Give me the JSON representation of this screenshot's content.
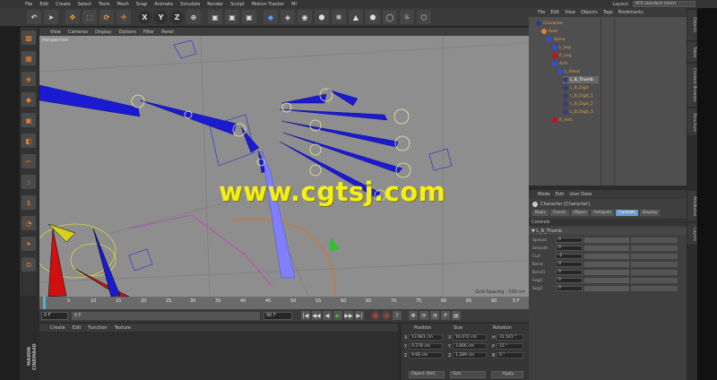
{
  "menubar": {
    "items": [
      "File",
      "Edit",
      "Create",
      "Select",
      "Tools",
      "Mesh",
      "Snap",
      "Animate",
      "Simulate",
      "Render",
      "Sculpt",
      "Motion Tracker",
      "Mi"
    ],
    "layout_label": "Layout:",
    "layout_value": "VFX standard (User)"
  },
  "toolbar": {
    "x_label": "X",
    "y_label": "Y",
    "z_label": "Z",
    "undo_icon": "↶",
    "pointer_icon": "➤",
    "move_icon": "✥",
    "scale_icon": "⬚",
    "rotate_icon": "⟳",
    "add_icon": "✛",
    "world_icon": "⊕",
    "render_icons": [
      "▣",
      "▣",
      "▣"
    ],
    "shape_icons": [
      "◆",
      "◈",
      "◉",
      "⬢",
      "❋",
      "▲",
      "⬣",
      "◯",
      "☼",
      "⬡"
    ]
  },
  "left_tools": [
    "▩",
    "▦",
    "◈",
    "◆",
    "▣",
    "◧",
    "⌐",
    "☝",
    "$",
    "◔",
    "✦",
    "⊜"
  ],
  "viewport": {
    "menu": [
      "View",
      "Cameras",
      "Display",
      "Options",
      "Filter",
      "Panel"
    ],
    "label": "Perspective",
    "grid_spacing": "Grid Spacing : 100 cm",
    "watermark": "www.cgtsj.com"
  },
  "timeline": {
    "ticks": [
      "0",
      "5",
      "10",
      "15",
      "20",
      "25",
      "30",
      "35",
      "40",
      "45",
      "50",
      "55",
      "60",
      "65",
      "70",
      "75",
      "80",
      "85",
      "90"
    ],
    "end_tick": "0 F",
    "start_field": "0 F",
    "current_field": "0 F",
    "end_field": "90 F",
    "buttons": [
      "|◀",
      "◀◀",
      "◀",
      "▶",
      "▶▶",
      "▶|",
      "●",
      "◉",
      "?",
      "✥",
      "⟳",
      "◔",
      "P",
      "▤"
    ]
  },
  "material": {
    "menu": [
      "Create",
      "Edit",
      "Function",
      "Texture"
    ],
    "logo": "MAXON CINEMA4D"
  },
  "coords": {
    "headers": [
      "Position",
      "Size",
      "Rotation"
    ],
    "rows": [
      {
        "axis": "X",
        "pos": "13.981 cm",
        "size_axis": "X",
        "size": "16.072 cm",
        "rot_axis": "H",
        "rot": "31.541 °"
      },
      {
        "axis": "Y",
        "pos": "0.278 cm",
        "size_axis": "Y",
        "size": "3.806 cm",
        "rot_axis": "P",
        "rot": "15 °"
      },
      {
        "axis": "Z",
        "pos": "9.68 cm",
        "size_axis": "Z",
        "size": "1.289 cm",
        "rot_axis": "B",
        "rot": "0 °"
      }
    ],
    "mode_select": "Object (Rel)",
    "size_select": "Size",
    "apply": "Apply"
  },
  "object_manager": {
    "menu": [
      "File",
      "Edit",
      "View",
      "Objects",
      "Tags",
      "Bookmarks"
    ],
    "items": [
      {
        "label": "Character",
        "level": 0,
        "selected": false
      },
      {
        "label": "Root",
        "level": 1,
        "selected": false
      },
      {
        "label": "Spine",
        "level": 2,
        "selected": false
      },
      {
        "label": "L_Leg",
        "level": 3,
        "selected": false
      },
      {
        "label": "R_Leg",
        "level": 3,
        "selected": false
      },
      {
        "label": "Arm",
        "level": 3,
        "selected": false
      },
      {
        "label": "L_Hand",
        "level": 4,
        "selected": false
      },
      {
        "label": "L_B_Thumb",
        "level": 5,
        "selected": true
      },
      {
        "label": "L_B_Digit",
        "level": 5,
        "selected": false
      },
      {
        "label": "L_B_Digit_1",
        "level": 5,
        "selected": false
      },
      {
        "label": "L_B_Digit_2",
        "level": 5,
        "selected": false
      },
      {
        "label": "L_B_Digit_3",
        "level": 5,
        "selected": false
      },
      {
        "label": "R_Arm",
        "level": 3,
        "selected": false
      }
    ]
  },
  "attribute_manager": {
    "menu": [
      "Mode",
      "Edit",
      "User Data"
    ],
    "title": "Character [Character]",
    "tabs": [
      "Basic",
      "Coord.",
      "Object",
      "Hotspots",
      "Controls",
      "Display"
    ],
    "active_tab": "Controls",
    "section": "Controls",
    "group": "▼ L_B_Thumb",
    "rows": [
      {
        "name": "Spread",
        "value": "0"
      },
      {
        "name": "Smooth",
        "value": "0"
      },
      {
        "name": "Curl",
        "value": "-2"
      },
      {
        "name": "Bend",
        "value": "0"
      },
      {
        "name": "Bend1",
        "value": "0"
      },
      {
        "name": "Seg1",
        "value": "0"
      },
      {
        "name": "Seg2",
        "value": "0"
      }
    ]
  },
  "side_tabs": [
    "Objects",
    "Takes",
    "Content Browser",
    "Structure",
    "Attributes",
    "Layers"
  ]
}
